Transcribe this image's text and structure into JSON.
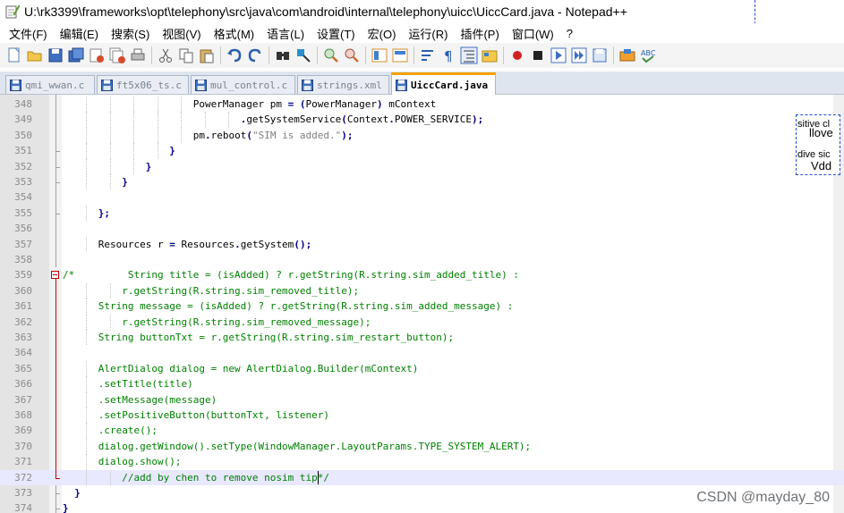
{
  "window": {
    "title": "U:\\rk3399\\frameworks\\opt\\telephony\\src\\java\\com\\android\\internal\\telephony\\uicc\\UiccCard.java - Notepad++"
  },
  "menu": {
    "items": [
      "文件(F)",
      "编辑(E)",
      "搜索(S)",
      "视图(V)",
      "格式(M)",
      "语言(L)",
      "设置(T)",
      "宏(O)",
      "运行(R)",
      "插件(P)",
      "窗口(W)",
      "?"
    ]
  },
  "toolbar": {
    "icons": [
      "new-file-icon",
      "open-file-icon",
      "save-icon",
      "save-all-icon",
      "close-icon",
      "close-all-icon",
      "print-icon",
      "cut-icon",
      "copy-icon",
      "paste-icon",
      "undo-icon",
      "redo-icon",
      "find-icon",
      "replace-icon",
      "zoom-in-icon",
      "zoom-out-icon",
      "sync-v-icon",
      "sync-h-icon",
      "word-wrap-icon",
      "show-all-chars-icon",
      "indent-guide-icon",
      "folder-icon",
      "record-macro-icon",
      "stop-macro-icon",
      "play-macro-icon",
      "run-macro-multiple-icon",
      "save-macro-icon",
      "translate-icon",
      "spellcheck-icon"
    ]
  },
  "tabs": [
    {
      "label": "qmi_wwan.c",
      "active": false
    },
    {
      "label": "ft5x06_ts.c",
      "active": false
    },
    {
      "label": "mul_control.c",
      "active": false
    },
    {
      "label": "strings.xml",
      "active": false
    },
    {
      "label": "UiccCard.java",
      "active": true
    }
  ],
  "popup": {
    "line1": "sitive cl",
    "line2": "llove",
    "line3": "dive sic",
    "line4": "Vdd"
  },
  "editor": {
    "current_line": 372,
    "lines": [
      {
        "n": "348",
        "code": "                      PowerManager pm = (PowerManager) mContext"
      },
      {
        "n": "349",
        "code": "                              .getSystemService(Context.POWER_SERVICE);"
      },
      {
        "n": "350",
        "code": "                      pm.reboot(\"SIM is added.\");"
      },
      {
        "n": "351",
        "code": "                  }"
      },
      {
        "n": "352",
        "code": "              }"
      },
      {
        "n": "353",
        "code": "          }"
      },
      {
        "n": "354",
        "code": ""
      },
      {
        "n": "355",
        "code": "      };"
      },
      {
        "n": "356",
        "code": ""
      },
      {
        "n": "357",
        "code": "      Resources r = Resources.getSystem();"
      },
      {
        "n": "358",
        "code": ""
      },
      {
        "n": "359",
        "code": "/*         String title = (isAdded) ? r.getString(R.string.sim_added_title) :"
      },
      {
        "n": "360",
        "code": "          r.getString(R.string.sim_removed_title);"
      },
      {
        "n": "361",
        "code": "      String message = (isAdded) ? r.getString(R.string.sim_added_message) :"
      },
      {
        "n": "362",
        "code": "          r.getString(R.string.sim_removed_message);"
      },
      {
        "n": "363",
        "code": "      String buttonTxt = r.getString(R.string.sim_restart_button);"
      },
      {
        "n": "364",
        "code": ""
      },
      {
        "n": "365",
        "code": "      AlertDialog dialog = new AlertDialog.Builder(mContext)"
      },
      {
        "n": "366",
        "code": "      .setTitle(title)"
      },
      {
        "n": "367",
        "code": "      .setMessage(message)"
      },
      {
        "n": "368",
        "code": "      .setPositiveButton(buttonTxt, listener)"
      },
      {
        "n": "369",
        "code": "      .create();"
      },
      {
        "n": "370",
        "code": "      dialog.getWindow().setType(WindowManager.LayoutParams.TYPE_SYSTEM_ALERT);"
      },
      {
        "n": "371",
        "code": "      dialog.show();"
      },
      {
        "n": "372",
        "code": "          //add by chen to remove nosim tip*/"
      },
      {
        "n": "373",
        "code": "  }"
      },
      {
        "n": "374",
        "code": "}"
      }
    ]
  },
  "watermark": "CSDN @mayday_80",
  "colors": {
    "comment": "#008000",
    "keyword": "#000080",
    "string": "#808080",
    "active_tab_accent": "#f5a000",
    "fold_marker": "#c00000"
  }
}
